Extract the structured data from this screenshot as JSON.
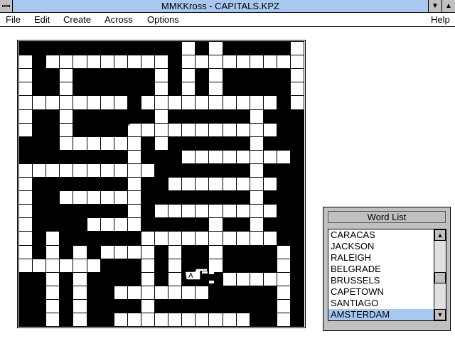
{
  "window": {
    "title": "MMKKross - CAPITALS.KPZ",
    "minimize_glyph": "▼",
    "maximize_glyph": "▲"
  },
  "menu": {
    "file": "File",
    "edit": "Edit",
    "create": "Create",
    "across": "Across",
    "options": "Options",
    "help": "Help"
  },
  "puzzle": {
    "marker": "*",
    "cursor_letter": "A",
    "cell_color": "#ffffff",
    "block_color": "#000000",
    "cells": [
      [
        12,
        0
      ],
      [
        14,
        0
      ],
      [
        20,
        0
      ],
      [
        0,
        1
      ],
      [
        2,
        1
      ],
      [
        3,
        1
      ],
      [
        4,
        1
      ],
      [
        5,
        1
      ],
      [
        6,
        1
      ],
      [
        7,
        1
      ],
      [
        8,
        1
      ],
      [
        9,
        1
      ],
      [
        10,
        1
      ],
      [
        12,
        1
      ],
      [
        13,
        1
      ],
      [
        14,
        1
      ],
      [
        15,
        1
      ],
      [
        16,
        1
      ],
      [
        17,
        1
      ],
      [
        18,
        1
      ],
      [
        19,
        1
      ],
      [
        20,
        1
      ],
      [
        0,
        2
      ],
      [
        3,
        2
      ],
      [
        10,
        2
      ],
      [
        12,
        2
      ],
      [
        14,
        2
      ],
      [
        20,
        2
      ],
      [
        0,
        3
      ],
      [
        3,
        3
      ],
      [
        10,
        3
      ],
      [
        12,
        3
      ],
      [
        14,
        3
      ],
      [
        20,
        3
      ],
      [
        0,
        4
      ],
      [
        1,
        4
      ],
      [
        2,
        4
      ],
      [
        3,
        4
      ],
      [
        4,
        4
      ],
      [
        5,
        4
      ],
      [
        6,
        4
      ],
      [
        7,
        4
      ],
      [
        9,
        4
      ],
      [
        10,
        4
      ],
      [
        11,
        4
      ],
      [
        12,
        4
      ],
      [
        13,
        4
      ],
      [
        14,
        4
      ],
      [
        15,
        4
      ],
      [
        16,
        4
      ],
      [
        17,
        4
      ],
      [
        18,
        4
      ],
      [
        20,
        4
      ],
      [
        0,
        5
      ],
      [
        3,
        5
      ],
      [
        10,
        5
      ],
      [
        17,
        5
      ],
      [
        0,
        6
      ],
      [
        3,
        6
      ],
      [
        8,
        6
      ],
      [
        9,
        6
      ],
      [
        10,
        6
      ],
      [
        11,
        6
      ],
      [
        12,
        6
      ],
      [
        13,
        6
      ],
      [
        14,
        6
      ],
      [
        15,
        6
      ],
      [
        16,
        6
      ],
      [
        17,
        6
      ],
      [
        18,
        6
      ],
      [
        3,
        7
      ],
      [
        4,
        7
      ],
      [
        5,
        7
      ],
      [
        6,
        7
      ],
      [
        7,
        7
      ],
      [
        8,
        7
      ],
      [
        10,
        7
      ],
      [
        17,
        7
      ],
      [
        8,
        8
      ],
      [
        12,
        8
      ],
      [
        13,
        8
      ],
      [
        14,
        8
      ],
      [
        15,
        8
      ],
      [
        16,
        8
      ],
      [
        17,
        8
      ],
      [
        18,
        8
      ],
      [
        19,
        8
      ],
      [
        0,
        9
      ],
      [
        1,
        9
      ],
      [
        2,
        9
      ],
      [
        3,
        9
      ],
      [
        4,
        9
      ],
      [
        5,
        9
      ],
      [
        6,
        9
      ],
      [
        7,
        9
      ],
      [
        8,
        9
      ],
      [
        9,
        9
      ],
      [
        17,
        9
      ],
      [
        0,
        10
      ],
      [
        8,
        10
      ],
      [
        11,
        10
      ],
      [
        12,
        10
      ],
      [
        13,
        10
      ],
      [
        14,
        10
      ],
      [
        15,
        10
      ],
      [
        16,
        10
      ],
      [
        17,
        10
      ],
      [
        18,
        10
      ],
      [
        0,
        11
      ],
      [
        3,
        11
      ],
      [
        4,
        11
      ],
      [
        5,
        11
      ],
      [
        6,
        11
      ],
      [
        7,
        11
      ],
      [
        8,
        11
      ],
      [
        17,
        11
      ],
      [
        0,
        12
      ],
      [
        8,
        12
      ],
      [
        10,
        12
      ],
      [
        11,
        12
      ],
      [
        12,
        12
      ],
      [
        13,
        12
      ],
      [
        14,
        12
      ],
      [
        15,
        12
      ],
      [
        16,
        12
      ],
      [
        17,
        12
      ],
      [
        18,
        12
      ],
      [
        0,
        13
      ],
      [
        5,
        13
      ],
      [
        6,
        13
      ],
      [
        7,
        13
      ],
      [
        8,
        13
      ],
      [
        14,
        13
      ],
      [
        17,
        13
      ],
      [
        0,
        14
      ],
      [
        2,
        14
      ],
      [
        9,
        14
      ],
      [
        10,
        14
      ],
      [
        11,
        14
      ],
      [
        12,
        14
      ],
      [
        13,
        14
      ],
      [
        14,
        14
      ],
      [
        15,
        14
      ],
      [
        16,
        14
      ],
      [
        17,
        14
      ],
      [
        18,
        14
      ],
      [
        0,
        15
      ],
      [
        2,
        15
      ],
      [
        4,
        15
      ],
      [
        6,
        15
      ],
      [
        7,
        15
      ],
      [
        8,
        15
      ],
      [
        9,
        15
      ],
      [
        11,
        15
      ],
      [
        14,
        15
      ],
      [
        19,
        15
      ],
      [
        0,
        16
      ],
      [
        1,
        16
      ],
      [
        2,
        16
      ],
      [
        3,
        16
      ],
      [
        4,
        16
      ],
      [
        5,
        16
      ],
      [
        9,
        16
      ],
      [
        11,
        16
      ],
      [
        14,
        16
      ],
      [
        19,
        16
      ],
      [
        2,
        17
      ],
      [
        4,
        17
      ],
      [
        9,
        17
      ],
      [
        11,
        17
      ],
      [
        15,
        17
      ],
      [
        16,
        17
      ],
      [
        17,
        17
      ],
      [
        18,
        17
      ],
      [
        19,
        17
      ],
      [
        2,
        18
      ],
      [
        4,
        18
      ],
      [
        7,
        18
      ],
      [
        8,
        18
      ],
      [
        9,
        18
      ],
      [
        10,
        18
      ],
      [
        11,
        18
      ],
      [
        12,
        18
      ],
      [
        13,
        18
      ],
      [
        19,
        18
      ],
      [
        2,
        19
      ],
      [
        4,
        19
      ],
      [
        9,
        19
      ],
      [
        19,
        19
      ],
      [
        2,
        20
      ],
      [
        4,
        20
      ],
      [
        7,
        20
      ],
      [
        8,
        20
      ],
      [
        9,
        20
      ],
      [
        10,
        20
      ],
      [
        11,
        20
      ],
      [
        12,
        20
      ],
      [
        13,
        20
      ],
      [
        14,
        20
      ],
      [
        15,
        20
      ],
      [
        16,
        20
      ],
      [
        19,
        20
      ]
    ]
  },
  "word_list": {
    "title": "Word List",
    "items": [
      "CARACAS",
      "JACKSON",
      "RALEIGH",
      "BELGRADE",
      "BRUSSELS",
      "CAPETOWN",
      "SANTIAGO",
      "AMSTERDAM"
    ],
    "selected": "AMSTERDAM",
    "selected_index": 7,
    "scroll_position": 0.55,
    "up_glyph": "▲",
    "down_glyph": "▼"
  }
}
